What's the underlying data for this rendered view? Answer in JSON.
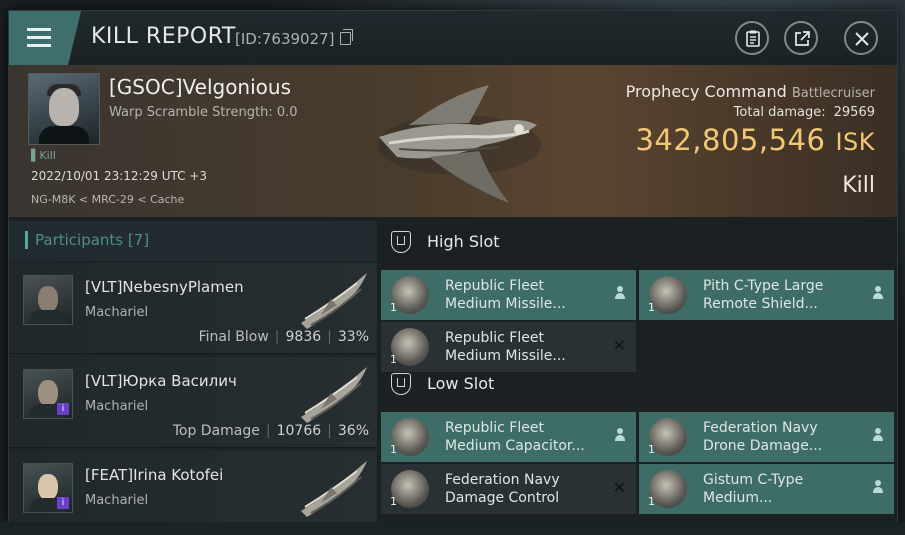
{
  "window": {
    "title": "KILL REPORT",
    "kill_id": "[ID:7639027]"
  },
  "victim": {
    "name": "[GSOC]Velgonious",
    "warp_scramble": "Warp Scramble Strength: 0.0",
    "kill_tag": "Kill",
    "timestamp": "2022/10/01 23:12:29 UTC +3",
    "location": "NG-M8K < MRC-29 < Cache",
    "ship_name": "Prophecy Command",
    "ship_class": "Battlecruiser",
    "total_damage_label": "Total damage:",
    "total_damage": "29569",
    "isk_value": "342,805,546",
    "isk_unit": "ISK",
    "result": "Kill"
  },
  "participants": {
    "header": "Participants [7]",
    "items": [
      {
        "name": "[VLT]NebesnyPlamen",
        "ship": "Machariel",
        "stat_label": "Final Blow",
        "damage": "9836",
        "percent": "33%",
        "face_color": "#8a7e72"
      },
      {
        "name": "[VLT]Юрка Василич",
        "ship": "Machariel",
        "stat_label": "Top Damage",
        "damage": "10766",
        "percent": "36%",
        "face_color": "#9c8f7e"
      },
      {
        "name": "[FEAT]Irina Kotofei",
        "ship": "Machariel",
        "stat_label": "",
        "damage": "",
        "percent": "",
        "face_color": "#d9c6aa"
      }
    ]
  },
  "slots": {
    "high": {
      "label": "High Slot",
      "modules": [
        {
          "name": "Republic Fleet Medium Missile...",
          "qty": "1",
          "style": "teal",
          "action": "person-icon"
        },
        {
          "name": "Pith C-Type Large Remote Shield...",
          "qty": "1",
          "style": "teal",
          "action": "person-icon"
        },
        {
          "name": "Republic Fleet Medium Missile...",
          "qty": "1",
          "style": "dark",
          "action": "close-icon"
        }
      ]
    },
    "low": {
      "label": "Low Slot",
      "modules": [
        {
          "name": "Republic Fleet Medium Capacitor...",
          "qty": "1",
          "style": "teal",
          "action": "person-icon"
        },
        {
          "name": "Federation Navy Drone Damage...",
          "qty": "1",
          "style": "teal",
          "action": "person-icon"
        },
        {
          "name": "Federation Navy Damage Control",
          "qty": "1",
          "style": "dark",
          "action": "close-icon"
        },
        {
          "name": "Gistum C-Type Medium...",
          "qty": "1",
          "style": "teal",
          "action": "person-icon"
        }
      ]
    }
  },
  "colors": {
    "accent_teal": "#3e6d68",
    "isk_gold": "#f2c877",
    "badge_purple": "#6a3fcc"
  }
}
